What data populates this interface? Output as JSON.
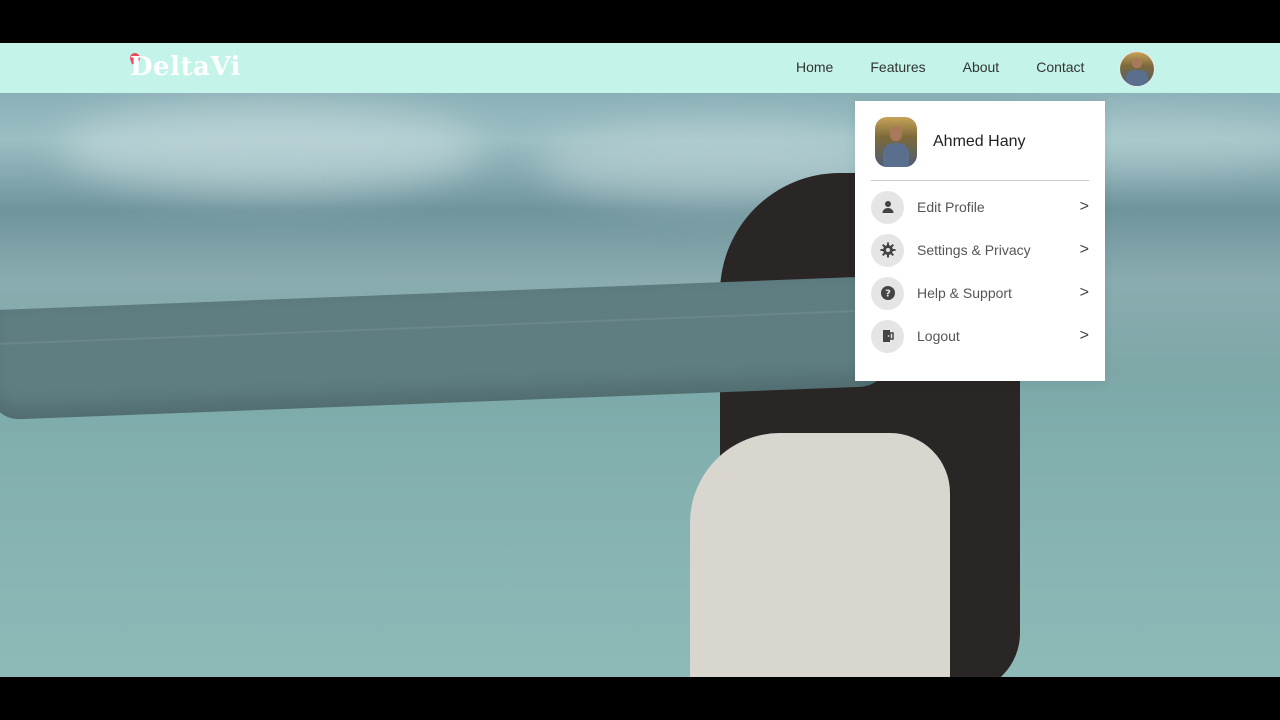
{
  "brand": {
    "name": "DeltaVi",
    "accent": "#ef4a5f"
  },
  "nav": {
    "links": [
      "Home",
      "Features",
      "About",
      "Contact"
    ]
  },
  "menu": {
    "user_name": "Ahmed Hany",
    "items": [
      {
        "label": "Edit Profile",
        "icon": "user-icon",
        "chevron": ">"
      },
      {
        "label": "Settings & Privacy",
        "icon": "gear-icon",
        "chevron": ">"
      },
      {
        "label": "Help & Support",
        "icon": "help-icon",
        "chevron": ">"
      },
      {
        "label": "Logout",
        "icon": "logout-icon",
        "chevron": ">"
      }
    ]
  },
  "colors": {
    "navbar": "#c3f3e9",
    "menu_bg": "#ffffff",
    "icon_bg": "#e5e5e5"
  }
}
